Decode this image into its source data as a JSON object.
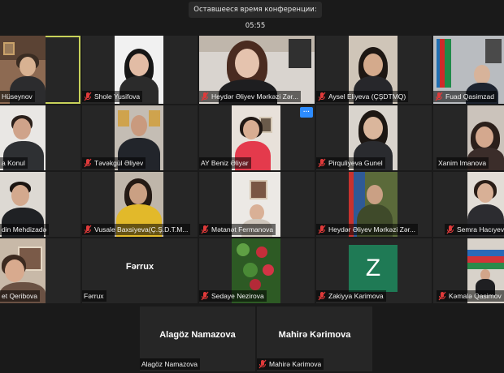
{
  "meeting": {
    "time_remaining": "Оставшееся время конференции: 05:55"
  },
  "participants": [
    {
      "name": "Hüseynov",
      "muted": false
    },
    {
      "name": "Shole Yusifova",
      "muted": true
    },
    {
      "name": "Heydər Əliyev Mərkəzi Zər...",
      "muted": true
    },
    {
      "name": "Aysel Eliyeva (ÇŞDTMQ)",
      "muted": true
    },
    {
      "name": "Fuad Qasimzad",
      "muted": true
    },
    {
      "name": "a Konul",
      "muted": false
    },
    {
      "name": "Təvəkgül Əliyev",
      "muted": true
    },
    {
      "name": "AY Beniz Əliyar",
      "muted": false
    },
    {
      "name": "Pirquliyeva Gunel",
      "muted": true
    },
    {
      "name": "Xanim Imanova",
      "muted": false
    },
    {
      "name": "din Mehdizadə",
      "muted": false
    },
    {
      "name": "Vusale Baxsiyeva(Ç.Ş.D.T.M...",
      "muted": true
    },
    {
      "name": "Mətanət Fermanova",
      "muted": true
    },
    {
      "name": "Heydər Əliyev Mərkəzi Zər...",
      "muted": true
    },
    {
      "name": "Semra Hacıyeva",
      "muted": true
    },
    {
      "name": "et Qeribova",
      "muted": false
    },
    {
      "name": "Fərrux",
      "muted": false
    },
    {
      "name": "Sedaye Nezirova",
      "muted": true
    },
    {
      "name": "Zakiyya Karimova",
      "muted": true
    },
    {
      "name": "Kəmalə Qasimov",
      "muted": true
    },
    {
      "name": "Alagöz Namazova",
      "muted": false
    },
    {
      "name": "Mahirə Kərimova",
      "muted": true
    }
  ],
  "placeholders": {
    "ferrux": "Fərrux",
    "alagoz": "Alagöz Namazova",
    "mahire": "Mahirə Kərimova",
    "zakiyya_initial": "Z"
  },
  "more_button": "···",
  "colors": {
    "active_speaker": "#c8d25a",
    "muted_icon": "#e03a3a",
    "avatar_green": "#1f7a55",
    "more_button": "#2d8cff"
  }
}
